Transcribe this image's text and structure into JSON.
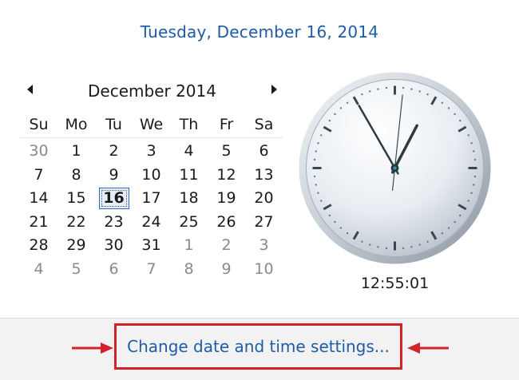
{
  "header": {
    "long_date": "Tuesday, December 16, 2014"
  },
  "calendar": {
    "month_title": "December 2014",
    "prev_icon": "chevron-left-icon",
    "next_icon": "chevron-right-icon",
    "days_of_week": [
      "Su",
      "Mo",
      "Tu",
      "We",
      "Th",
      "Fr",
      "Sa"
    ],
    "weeks": [
      [
        {
          "d": "30",
          "dim": true
        },
        {
          "d": "1"
        },
        {
          "d": "2"
        },
        {
          "d": "3"
        },
        {
          "d": "4"
        },
        {
          "d": "5"
        },
        {
          "d": "6"
        }
      ],
      [
        {
          "d": "7"
        },
        {
          "d": "8"
        },
        {
          "d": "9"
        },
        {
          "d": "10"
        },
        {
          "d": "11"
        },
        {
          "d": "12"
        },
        {
          "d": "13"
        }
      ],
      [
        {
          "d": "14"
        },
        {
          "d": "15"
        },
        {
          "d": "16",
          "today": true
        },
        {
          "d": "17"
        },
        {
          "d": "18"
        },
        {
          "d": "19"
        },
        {
          "d": "20"
        }
      ],
      [
        {
          "d": "21"
        },
        {
          "d": "22"
        },
        {
          "d": "23"
        },
        {
          "d": "24"
        },
        {
          "d": "25"
        },
        {
          "d": "26"
        },
        {
          "d": "27"
        }
      ],
      [
        {
          "d": "28"
        },
        {
          "d": "29"
        },
        {
          "d": "30"
        },
        {
          "d": "31"
        },
        {
          "d": "1",
          "dim": true
        },
        {
          "d": "2",
          "dim": true
        },
        {
          "d": "3",
          "dim": true
        }
      ],
      [
        {
          "d": "4",
          "dim": true
        },
        {
          "d": "5",
          "dim": true
        },
        {
          "d": "6",
          "dim": true
        },
        {
          "d": "7",
          "dim": true
        },
        {
          "d": "8",
          "dim": true
        },
        {
          "d": "9",
          "dim": true
        },
        {
          "d": "10",
          "dim": true
        }
      ]
    ]
  },
  "clock": {
    "time_text": "12:55:01",
    "hours": 12,
    "minutes": 55,
    "seconds": 1
  },
  "footer": {
    "settings_link": "Change date and time settings..."
  },
  "colors": {
    "link_blue": "#1e5ba8",
    "annotation_red": "#d2232a",
    "footer_bg": "#f2f2f2"
  }
}
